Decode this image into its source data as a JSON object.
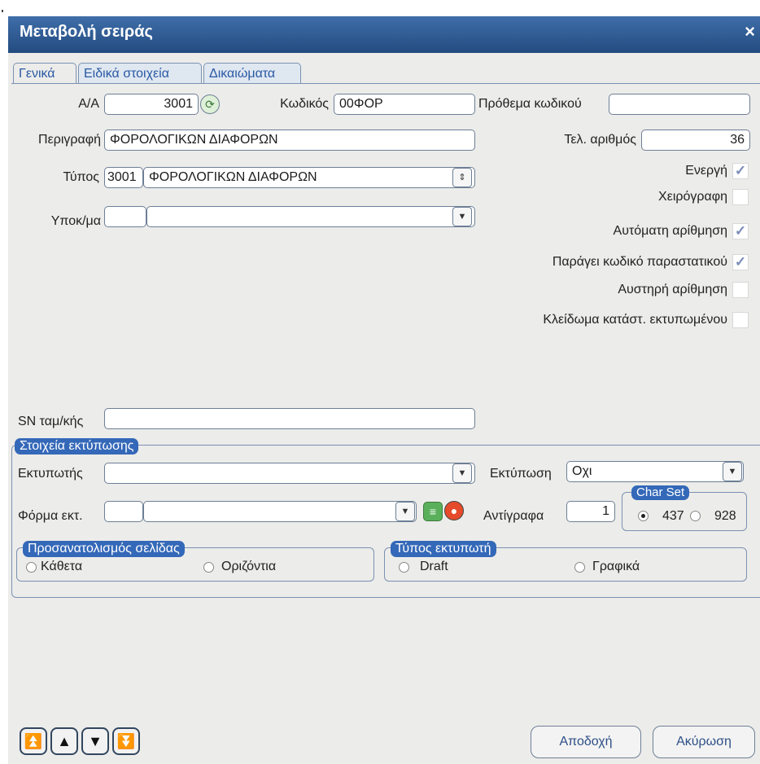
{
  "window": {
    "title": "Μεταβολή σειράς",
    "close_label": "×"
  },
  "tabs": [
    {
      "label": "Γενικά"
    },
    {
      "label": "Ειδικά στοιχεία"
    },
    {
      "label": "Δικαιώματα"
    }
  ],
  "general": {
    "aa": {
      "label": "Α/Α",
      "value": "3001"
    },
    "code": {
      "label": "Κωδικός",
      "value": "00ΦΟΡ"
    },
    "prefix": {
      "label": "Πρόθεμα κωδικού",
      "value": ""
    },
    "description": {
      "label": "Περιγραφή",
      "value": "ΦΟΡΟΛΟΓΙΚΩΝ ΔΙΑΦΟΡΩΝ"
    },
    "last_number": {
      "label": "Τελ. αριθμός",
      "value": "36"
    },
    "type": {
      "label": "Τύπος",
      "code": "3001",
      "value": "ΦΟΡΟΛΟΓΙΚΩΝ ΔΙΑΦΟΡΩΝ"
    },
    "branch": {
      "label": "Υποκ/μα",
      "code": "",
      "value": ""
    },
    "sn": {
      "label": "SN ταμ/κής",
      "value": ""
    }
  },
  "checkboxes": [
    {
      "label": "Ενεργή",
      "checked": true
    },
    {
      "label": "Χειρόγραφη",
      "checked": false
    },
    {
      "label": "Αυτόματη αρίθμηση",
      "checked": true
    },
    {
      "label": "Παράγει κωδικό παραστατικού",
      "checked": true
    },
    {
      "label": "Αυστηρή αρίθμηση",
      "checked": false
    },
    {
      "label": "Κλείδωμα κατάστ. εκτυπωμένου",
      "checked": false
    }
  ],
  "print": {
    "group_title": "Στοιχεία εκτύπωσης",
    "printer": {
      "label": "Εκτυπωτής",
      "value": ""
    },
    "print_mode": {
      "label": "Εκτύπωση",
      "value": "Οχι"
    },
    "form": {
      "label": "Φόρμα εκτ.",
      "code": "",
      "value": ""
    },
    "copies": {
      "label": "Αντίγραφα",
      "value": "1"
    },
    "charset": {
      "title": "Char Set",
      "options": [
        "437",
        "928"
      ],
      "selected": "437"
    },
    "orientation": {
      "title": "Προσανατολισμός σελίδας",
      "options": [
        "Κάθετα",
        "Οριζόντια"
      ],
      "selected": ""
    },
    "printer_type": {
      "title": "Τύπος εκτυπωτή",
      "options": [
        "Draft",
        "Γραφικά"
      ],
      "selected": ""
    }
  },
  "nav": {
    "first": "⏫",
    "prev": "▲",
    "next": "▼",
    "last": "⏬"
  },
  "buttons": {
    "accept": "Αποδοχή",
    "cancel": "Ακύρωση"
  },
  "colors": {
    "titlebar": "#2d5a92",
    "group_title_bg": "#3468b8",
    "tab_text": "#2a59a4",
    "check": "#7a8db8"
  }
}
